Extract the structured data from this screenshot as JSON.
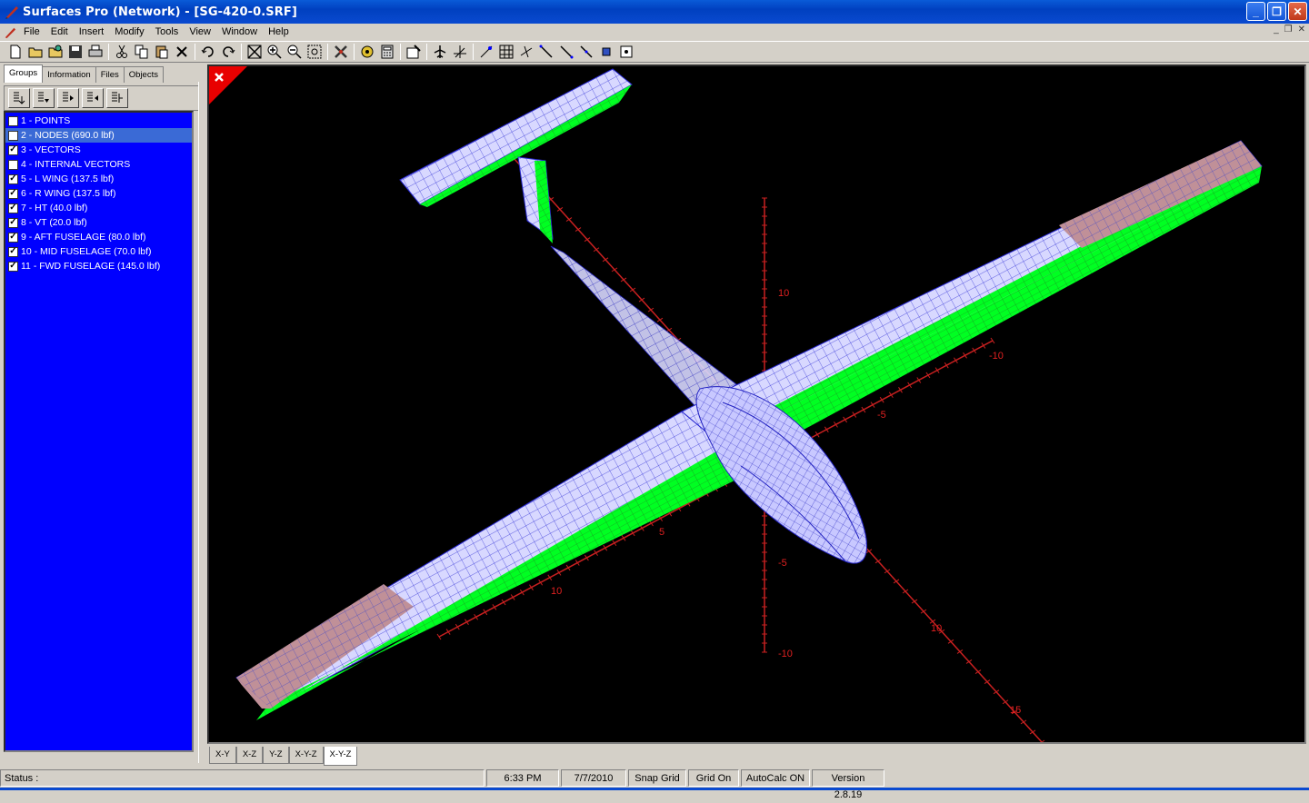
{
  "window": {
    "title": "Surfaces Pro (Network) - [SG-420-0.SRF]",
    "min": "_",
    "max": "❐",
    "close": "✕"
  },
  "menu": [
    "File",
    "Edit",
    "Insert",
    "Modify",
    "Tools",
    "View",
    "Window",
    "Help"
  ],
  "mdi_controls": [
    "_",
    "❐",
    "✕"
  ],
  "left_tabs": [
    "Groups",
    "Information",
    "Files",
    "Objects"
  ],
  "groups": [
    {
      "label": "1 - POINTS",
      "checked": false,
      "selected": false
    },
    {
      "label": "2 - NODES (690.0 lbf)",
      "checked": false,
      "selected": true
    },
    {
      "label": "3 - VECTORS",
      "checked": true,
      "selected": false
    },
    {
      "label": "4 - INTERNAL VECTORS",
      "checked": false,
      "selected": false
    },
    {
      "label": "5 - L WING (137.5 lbf)",
      "checked": true,
      "selected": false
    },
    {
      "label": "6 - R WING (137.5 lbf)",
      "checked": true,
      "selected": false
    },
    {
      "label": "7 - HT (40.0 lbf)",
      "checked": true,
      "selected": false
    },
    {
      "label": "8 - VT (20.0 lbf)",
      "checked": true,
      "selected": false
    },
    {
      "label": "9 - AFT FUSELAGE (80.0 lbf)",
      "checked": true,
      "selected": false
    },
    {
      "label": "10 - MID FUSELAGE (70.0 lbf)",
      "checked": true,
      "selected": false
    },
    {
      "label": "11 - FWD FUSELAGE (145.0 lbf)",
      "checked": true,
      "selected": false
    }
  ],
  "axis_labels": {
    "z_pos": "10",
    "z_neg5": "-5",
    "z_neg10": "-10",
    "y_neg5": "-5",
    "y_neg10": "-10",
    "y_5": "5",
    "y_10": "10",
    "x_10": "10",
    "x_15": "15"
  },
  "view_tabs": [
    "X-Y",
    "X-Z",
    "Y-Z",
    "X-Y-Z",
    "X-Y-Z"
  ],
  "status": {
    "label": "Status :",
    "time": "6:33 PM",
    "date": "7/7/2010",
    "snap": "Snap Grid",
    "grid": "Grid On",
    "autocalc": "AutoCalc ON",
    "version": "Version 2.8.19"
  },
  "colors": {
    "wing_top": "#d8d8ff",
    "wing_green": "#00ff22",
    "mesh": "#2828d0",
    "axis": "#c82020",
    "list_bg": "#0000ff"
  }
}
